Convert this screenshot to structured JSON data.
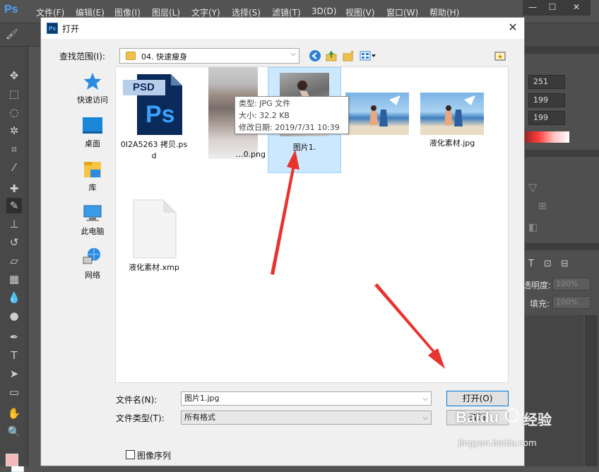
{
  "ps": {
    "logo": "Ps",
    "menus": [
      "文件(F)",
      "编辑(E)",
      "图像(I)",
      "图层(L)",
      "文字(Y)",
      "选择(S)",
      "滤镜(T)",
      "3D(D)",
      "视图(V)",
      "窗口(W)",
      "帮助(H)"
    ],
    "window_buttons": [
      "—",
      "☐",
      "✕"
    ],
    "right_panel": {
      "values": [
        "251",
        "199",
        "199"
      ],
      "opacity_label": "透明度:",
      "opacity_value": "100%",
      "fill_label": "填充:",
      "fill_value": "100%",
      "layer_icons": [
        "T",
        "⊡",
        "⊟"
      ]
    }
  },
  "dialog": {
    "title": "打开",
    "close": "✕",
    "icon_text": "Ps",
    "lookin_label": "查找范围(I):",
    "lookin_value": "04. 快速瘦身",
    "places": [
      {
        "label": "快速访问",
        "icon": "star-icon"
      },
      {
        "label": "桌面",
        "icon": "desktop-icon"
      },
      {
        "label": "库",
        "icon": "library-icon"
      },
      {
        "label": "此电脑",
        "icon": "computer-icon"
      },
      {
        "label": "网络",
        "icon": "network-icon"
      }
    ],
    "files": [
      {
        "name": "0I2A5263 拷贝.psd",
        "type": "psd",
        "icon_text": "PSD",
        "badge": "Ps"
      },
      {
        "name": "…0.png",
        "type": "png-blurred"
      },
      {
        "name": "图片1.",
        "type": "jpg-selected"
      },
      {
        "name": "",
        "type": "jpg-beach"
      },
      {
        "name": "液化素材.jpg",
        "type": "jpg-beach"
      },
      {
        "name": "液化素材.xmp",
        "type": "xmp"
      }
    ],
    "tooltip": {
      "type": "类型: JPG 文件",
      "size": "大小: 32.2 KB",
      "modified": "修改日期: 2019/7/31 10:39"
    },
    "filename_label": "文件名(N):",
    "filename_value": "图片1.jpg",
    "filetype_label": "文件类型(T):",
    "filetype_value": "所有格式",
    "open_button": "打开(O)",
    "cancel_button": "取消",
    "sequence_label": "图像序列"
  },
  "watermark": {
    "brand": "Baidu",
    "product": "经验",
    "url": "jingyan.baidu.com"
  },
  "colors": {
    "accent": "#2d7fd3",
    "arrow": "#e8332e",
    "selection": "#cce8ff"
  }
}
